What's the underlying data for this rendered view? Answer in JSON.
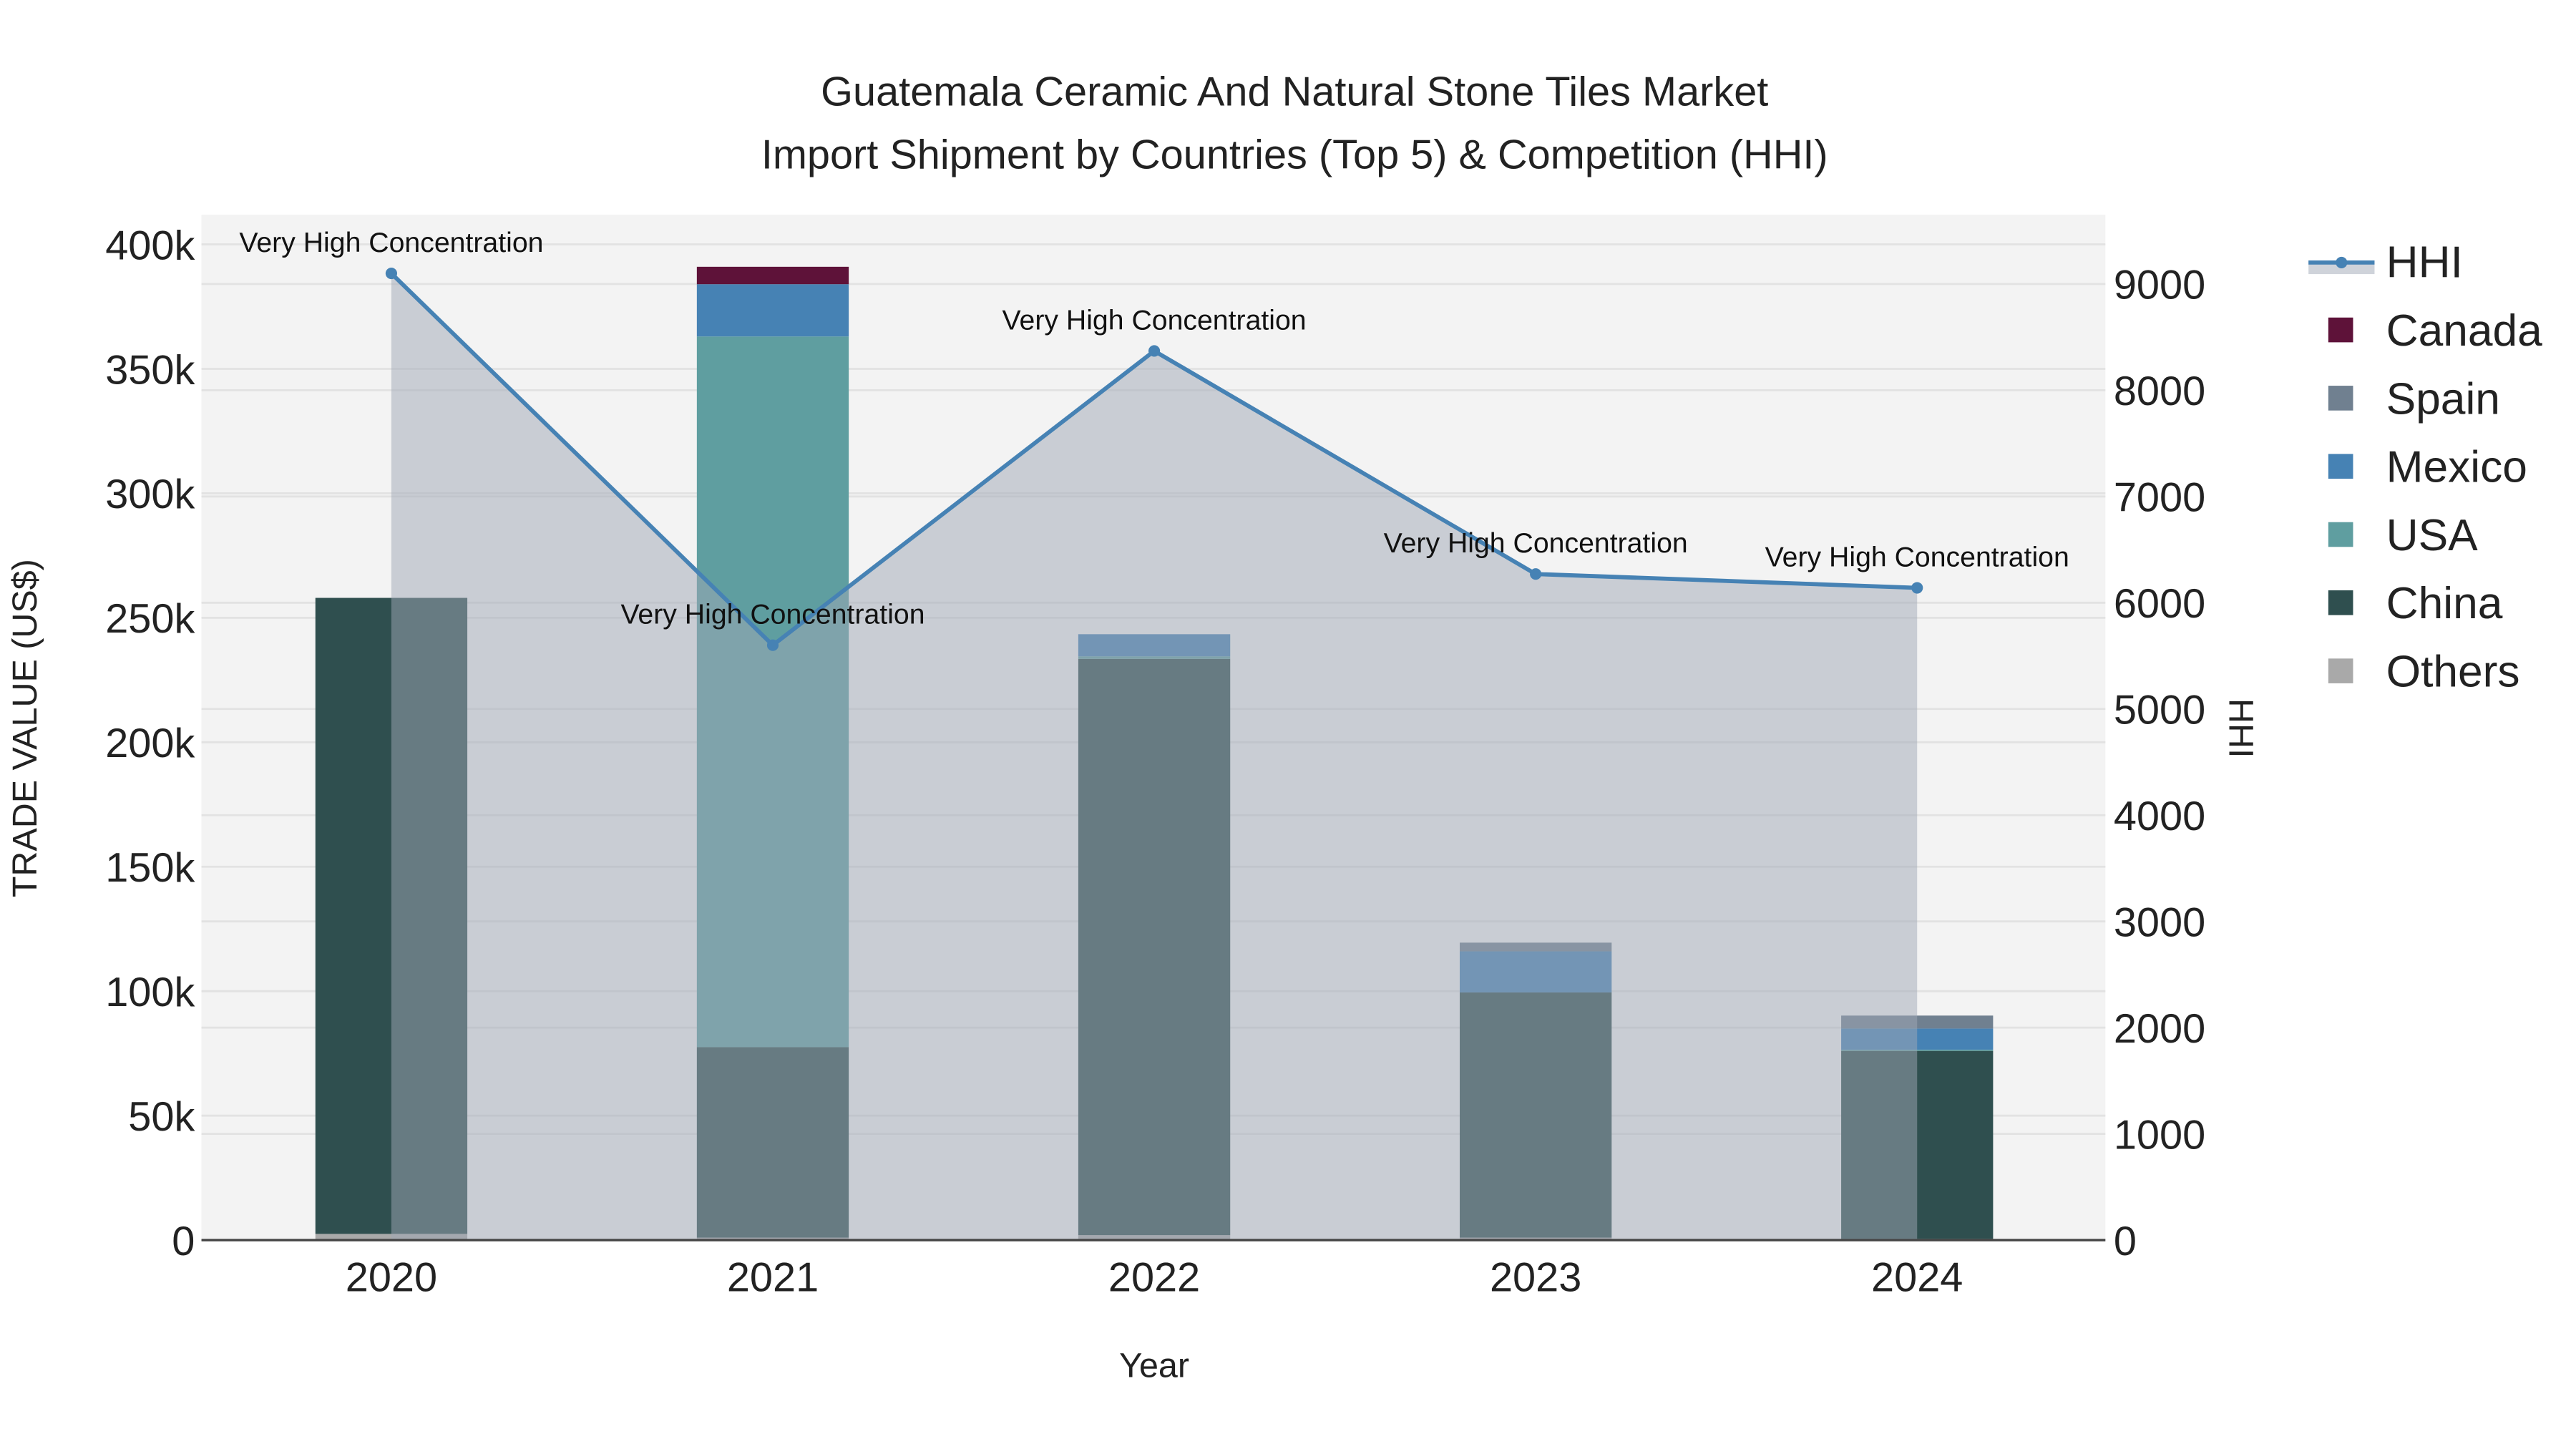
{
  "chart_data": {
    "type": "bar",
    "title_line1": "Guatemala Ceramic And Natural Stone Tiles Market",
    "title_line2": "Import Shipment by Countries (Top 5) & Competition (HHI)",
    "xlabel": "Year",
    "ylabel": "TRADE VALUE (US$)",
    "y2label": "HHI",
    "categories": [
      "2020",
      "2021",
      "2022",
      "2023",
      "2024"
    ],
    "ylim": [
      0,
      410000
    ],
    "y2lim": [
      0,
      9650
    ],
    "yticks": [
      0,
      50000,
      100000,
      150000,
      200000,
      250000,
      300000,
      350000,
      400000
    ],
    "ytick_labels": [
      "0",
      "50k",
      "100k",
      "150k",
      "200k",
      "250k",
      "300k",
      "350k",
      "400k"
    ],
    "y2ticks": [
      0,
      1000,
      2000,
      3000,
      4000,
      5000,
      6000,
      7000,
      8000,
      9000
    ],
    "y2tick_labels": [
      "0",
      "1000",
      "2000",
      "3000",
      "4000",
      "5000",
      "6000",
      "7000",
      "8000",
      "9000"
    ],
    "series": [
      {
        "name": "Others",
        "color": "#A9A9A9",
        "values": [
          2500,
          1000,
          2000,
          1000,
          500
        ]
      },
      {
        "name": "China",
        "color": "#2F4F4F",
        "values": [
          255500,
          76500,
          231500,
          98500,
          75500
        ]
      },
      {
        "name": "USA",
        "color": "#5F9EA0",
        "values": [
          0,
          285500,
          1000,
          0,
          500
        ]
      },
      {
        "name": "Mexico",
        "color": "#4682B4",
        "values": [
          0,
          21000,
          8900,
          16500,
          8500
        ]
      },
      {
        "name": "Spain",
        "color": "#708090",
        "values": [
          0,
          0,
          0,
          3500,
          5200
        ]
      },
      {
        "name": "Canada",
        "color": "#5E1239",
        "values": [
          0,
          7000,
          0,
          0,
          0
        ]
      }
    ],
    "hhi": {
      "name": "HHI",
      "color": "#4682B4",
      "values": [
        9100,
        5600,
        8370,
        6270,
        6140
      ],
      "annotations": [
        "Very High Concentration",
        "Very High Concentration",
        "Very High Concentration",
        "Very High Concentration",
        "Very High Concentration"
      ]
    },
    "legend": [
      "HHI",
      "Canada",
      "Spain",
      "Mexico",
      "USA",
      "China",
      "Others"
    ],
    "legend_placement": "right",
    "grid": true
  }
}
